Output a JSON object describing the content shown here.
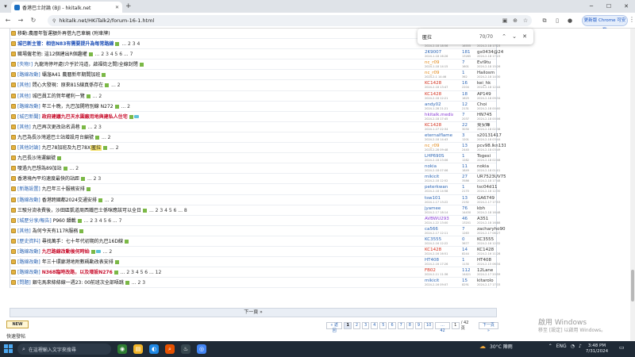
{
  "browser": {
    "tab_title": "香港巴士討論 (BJ) - hkitalk.net",
    "url": "hkitalk.net/HKiTalk2/forum-16-1.html",
    "update_label": "更新版 Chrome 可安裝",
    "find": {
      "query": "匿拉",
      "count": "70/70"
    }
  },
  "forum": {
    "threads": [
      {
        "prefix": "",
        "title": "移動:農曆年暫運額外再借九巴車輛 (附車牌)",
        "style": "normal",
        "author": "",
        "author_date": "",
        "replies": "",
        "views": "",
        "last": "",
        "last_date": "",
        "pages": ""
      },
      {
        "prefix": "",
        "title": "城巴新主管：相信N83有需要提升為每常路線",
        "style": "bold-blue",
        "author": "mb2635",
        "author_date": "2024-2-18 18:56",
        "replies": "69",
        "views": "16555",
        "last": "szeto993",
        "last_date": "2024-2-18 17:23",
        "pages": "... 2 3 4"
      },
      {
        "prefix": "",
        "title": "職場僱老他: 這12個建出R個趣權",
        "style": "normal",
        "author": "2K9007",
        "author_date": "2024-1-18 16:26",
        "replies": "181",
        "views": "13285",
        "last": "gx0434@24",
        "last_date": "2024-2-18 17:23",
        "pages": "... 2 3 4 5 6 ... 7"
      },
      {
        "prefix": "[失物!]",
        "title": "九龍灣停坪處(介乎於沌道，啟福街之間)全線封閉",
        "style": "normal",
        "author": "nc_r09",
        "author_date": "2024-1-18 14:15",
        "replies": "7",
        "views": "1601",
        "last": "Evi9tu",
        "last_date": "2024-2-18 15:26",
        "pages": ""
      },
      {
        "prefix": "[路線改動]",
        "title": "壩溜A41 農曆新年期間加班",
        "style": "normal",
        "author": "nc_r09",
        "author_date": "2024-2-1 14:46",
        "replies": "1",
        "views": "362",
        "last": "Hailosm",
        "last_date": "2024-2-18 14:30",
        "pages": ""
      },
      {
        "prefix": "[其他]",
        "title": "問心大發現：原來815線真係存在",
        "style": "normal",
        "author": "KC1428",
        "author_date": "2024-2-18 13:47",
        "replies": "16",
        "views": "2204",
        "last": "kei_hk",
        "last_date": "2024-2-18 12:44",
        "pages": "... 2"
      },
      {
        "prefix": "[其他]",
        "title": "城巴員工的賀年權利一覽",
        "style": "normal",
        "author": "KC1428",
        "author_date": "2024-2-18 12:21",
        "replies": "18",
        "views": "1625",
        "last": "AP149",
        "last_date": "2024-2-18 09:34",
        "pages": "... 2"
      },
      {
        "prefix": "[路線改動]",
        "title": "年三十晚，九巴加開特別線 N272",
        "style": "normal",
        "author": "andy02",
        "author_date": "2024-1-28 21:21",
        "replies": "12",
        "views": "2131",
        "last": "Choi",
        "last_date": "2024-2-18 00:00",
        "pages": "... 2"
      },
      {
        "prefix": "[城巴新聞]",
        "title": "政府建議九巴天水圍廠用地與建私人住宅",
        "style": "bold-red",
        "author": "hkitalk.media",
        "author_date": "2024-2-18 17:45",
        "replies": "7",
        "views": "2037",
        "last": "HN745",
        "last_date": "2024-2-18 00:06",
        "pages": ""
      },
      {
        "prefix": "[其他]",
        "title": "九巴再次更改站名渦巷",
        "style": "normal",
        "author": "KC1428",
        "author_date": "2024-1-27 22:34",
        "replies": "22",
        "views": "3030",
        "last": "吳安峰",
        "last_date": "2024-2-18 02:38",
        "pages": "... 2 3"
      },
      {
        "prefix": "",
        "title": "九巴為長沙灣遞巴士站增設月台編號",
        "style": "normal",
        "author": "eternalflame",
        "author_date": "2024-2-18 14:43",
        "replies": "3",
        "views": "1201",
        "last": "s20131417",
        "last_date": "2024-2-18 03:44",
        "pages": "... 2"
      },
      {
        "prefix": "[其他討論]",
        "title": "九巴78加班及九巴78X",
        "style": "normal",
        "mark": "匿拉",
        "author": "nc_r09",
        "author_date": "2024-2-28 09:48",
        "replies": "13",
        "views": "2440",
        "last": "pcv98.lkn131",
        "last_date": "2024-2-18 03:49",
        "pages": "... 2"
      },
      {
        "prefix": "",
        "title": "九巴長沙灣運編號",
        "style": "normal",
        "author": "LHP690S",
        "author_date": "2024-2-18 23:06",
        "replies": "1",
        "views": "1282",
        "last": "Togesi",
        "last_date": "2024-2-18 02:08",
        "pages": ""
      },
      {
        "prefix": "",
        "title": "嗄過九巴想為89加站",
        "style": "normal",
        "author": "nokia",
        "author_date": "2024-2-18 07:06",
        "replies": "11",
        "views": "1849",
        "last": "nokia",
        "last_date": "2024-2-18 01:01",
        "pages": "... 2"
      },
      {
        "prefix": "",
        "title": "香港境內平均速度最快的站距",
        "style": "normal",
        "author": "mikicit",
        "author_date": "2024-2-18 12:52",
        "replies": "27",
        "views": "3586",
        "last": "UR7523UV7525",
        "last_date": "2024-2-18 17:48",
        "pages": "... 2 3"
      },
      {
        "prefix": "[新路設置]",
        "title": "九巴年三十服務安排",
        "style": "normal",
        "author": "peterkwan",
        "author_date": "2024-2-18 14:58",
        "replies": "1",
        "views": "2170",
        "last": "tsc04d11",
        "last_date": "2024-2-18 12:30",
        "pages": ""
      },
      {
        "prefix": "[路線改動]",
        "title": "香港跨國都2024交通安排",
        "style": "normal",
        "author": "tsw101",
        "author_date": "2024-1-17 13:22",
        "replies": "13",
        "views": "2192",
        "last": "GA6749",
        "last_date": "2024-2-17 17:53",
        "pages": "... 2"
      },
      {
        "prefix": "",
        "title": "三駿分流收費後，沙田區凱道周西鐵巴士係咪應該可以全日",
        "style": "normal",
        "author": "jyamee",
        "author_date": "2024-2-17 18:14",
        "replies": "76",
        "views": "14430",
        "last": "kbh",
        "last_date": "2024-2-18 16:48",
        "pages": "... 2 3 4 5 6 ... 8"
      },
      {
        "prefix": "[城歷分享/報告]",
        "title": "P960 韻載",
        "style": "normal",
        "author": "AVBWU293",
        "author_date": "2024-1-22 13:00",
        "replies": "46",
        "views": "13201",
        "last": "A351",
        "last_date": "2024-2-18 16:88",
        "pages": "... 2 3 4 5 6 ... 7"
      },
      {
        "prefix": "[其他]",
        "title": "為何今天有117R服務",
        "style": "normal",
        "author": "ca566",
        "author_date": "2024-2-17 12:11",
        "replies": "7",
        "views": "1263",
        "last": "zacharyho907",
        "last_date": "2024-2-17 06:27",
        "pages": ""
      },
      {
        "prefix": "[歷史資料]",
        "title": "尋找萬手：七十年代初期的九巴16D線",
        "style": "normal",
        "author": "KC3555",
        "author_date": "2024-2-16 12:22",
        "replies": "0",
        "views": "3677",
        "last": "KC3555",
        "last_date": "2024-2-16 12:32",
        "pages": ""
      },
      {
        "prefix": "[路線改動]",
        "title": "九巴路線改動後何時始",
        "style": "bold-red",
        "author": "KC1428",
        "author_date": "2024-2-16 16:51",
        "replies": "14",
        "views": "8244",
        "last": "KC1428",
        "last_date": "2024-2-16 11:28",
        "pages": "... 2"
      },
      {
        "prefix": "[路線改動]",
        "title": "年三十環廊港地附數碼動改表安排",
        "style": "normal",
        "author": "HT408",
        "author_date": "2024-2-16 17:26",
        "replies": "1",
        "views": "1130",
        "last": "HT408",
        "last_date": "2024-2-15 06:34",
        "pages": ""
      },
      {
        "prefix": "[路線改動]",
        "title": "N368臨時改路，以及增設N276",
        "style": "bold-red",
        "author": "FB02",
        "author_date": "2024-2-11 11:36",
        "replies": "112",
        "views": "14421",
        "last": "12Lane",
        "last_date": "2024-2-17 20:59",
        "pages": "... 2 3 4 5 6 ... 12"
      },
      {
        "prefix": "[問題]",
        "title": "銀屯馬來條條線一週23: 00前班次全部唔跳",
        "style": "normal",
        "author": "mikicit",
        "author_date": "2024-2-16 09:07",
        "replies": "15",
        "views": "8291",
        "last": "kitarolo",
        "last_date": "2024-2-17 17:33",
        "pages": "... 2 3"
      }
    ],
    "next_page_label": "下一頁 »",
    "new_button": "NEW",
    "pager": {
      "back": "« 返回",
      "pages": [
        "1",
        "2",
        "3",
        "4",
        "5",
        "6",
        "7",
        "8",
        "9",
        "10",
        "... 42"
      ],
      "current": "1",
      "input": "1",
      "total": "/ 42 頁",
      "next": "下一頁 »"
    },
    "bottom_label": "快速發帖"
  },
  "watermark": {
    "line1": "啟用 Windows",
    "line2": "移至 [設定] 以啟用 Windows。"
  },
  "taskbar": {
    "search_placeholder": "在這裡輸入文字來搜尋",
    "weather": "30°C 陣雨",
    "lang": "ENG",
    "time": "3:48 PM",
    "date": "7/31/2024"
  },
  "colors": {
    "link_blue": "#2d66b5",
    "highlight_red": "#c8102e",
    "folder_gold": "#e3b13f",
    "taskbar": "#1f2a36"
  }
}
